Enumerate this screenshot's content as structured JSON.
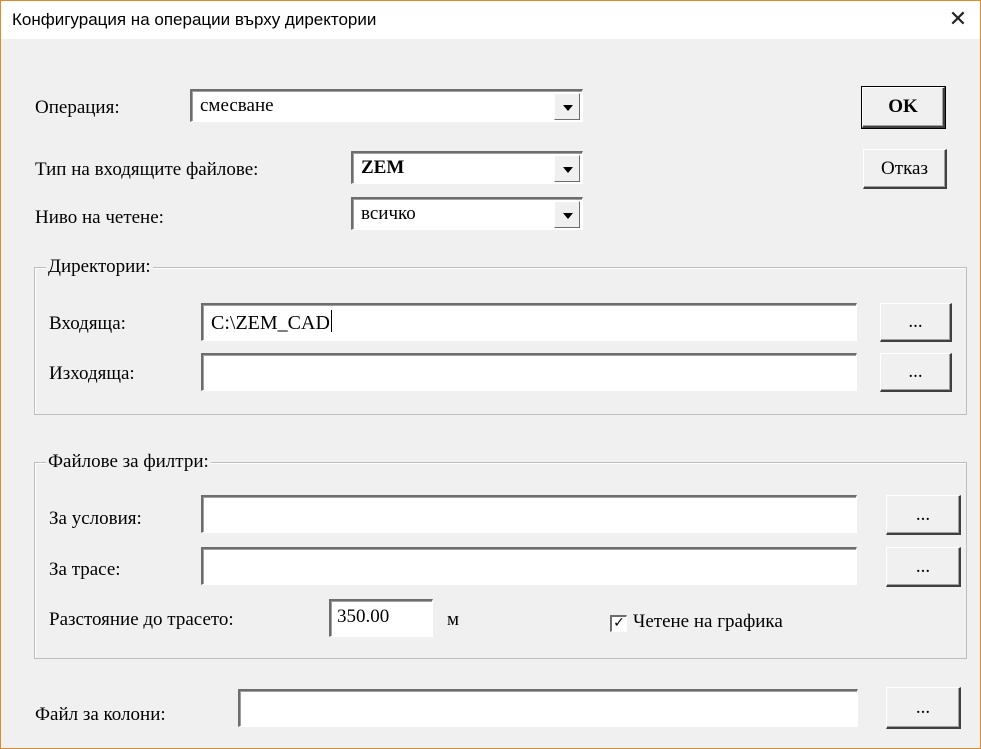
{
  "window": {
    "title": "Конфигурация на операции върху директории",
    "close_glyph": "✕"
  },
  "operation": {
    "label": "Операция:",
    "value": "смесване"
  },
  "input_type": {
    "label": "Тип на входящите файлове:",
    "value": "ZEM"
  },
  "read_level": {
    "label": "Ниво на четене:",
    "value": "всичко"
  },
  "buttons": {
    "ok": "OK",
    "cancel": "Отказ",
    "browse": "..."
  },
  "directories": {
    "legend": "Директории:",
    "input_label": "Входяща:",
    "input_value": "C:\\ZEM_CAD",
    "output_label": "Изходяща:",
    "output_value": ""
  },
  "filters": {
    "legend": "Файлове за филтри:",
    "conditions_label": "За условия:",
    "conditions_value": "",
    "route_label": "За трасе:",
    "route_value": "",
    "distance_label": "Разстояние до трасето:",
    "distance_value": "350.00",
    "distance_unit": "м",
    "graphics_label": "Четене на графика",
    "graphics_checked": true,
    "check_glyph": "✓"
  },
  "columns": {
    "label": "Файл за колони:",
    "value": ""
  },
  "colors": {
    "title_border": "#e08a2c",
    "background": "#f0f0f0"
  },
  "icons": {
    "close": "close-icon",
    "dropdown": "chevron-down-icon",
    "check": "checkmark-icon"
  }
}
